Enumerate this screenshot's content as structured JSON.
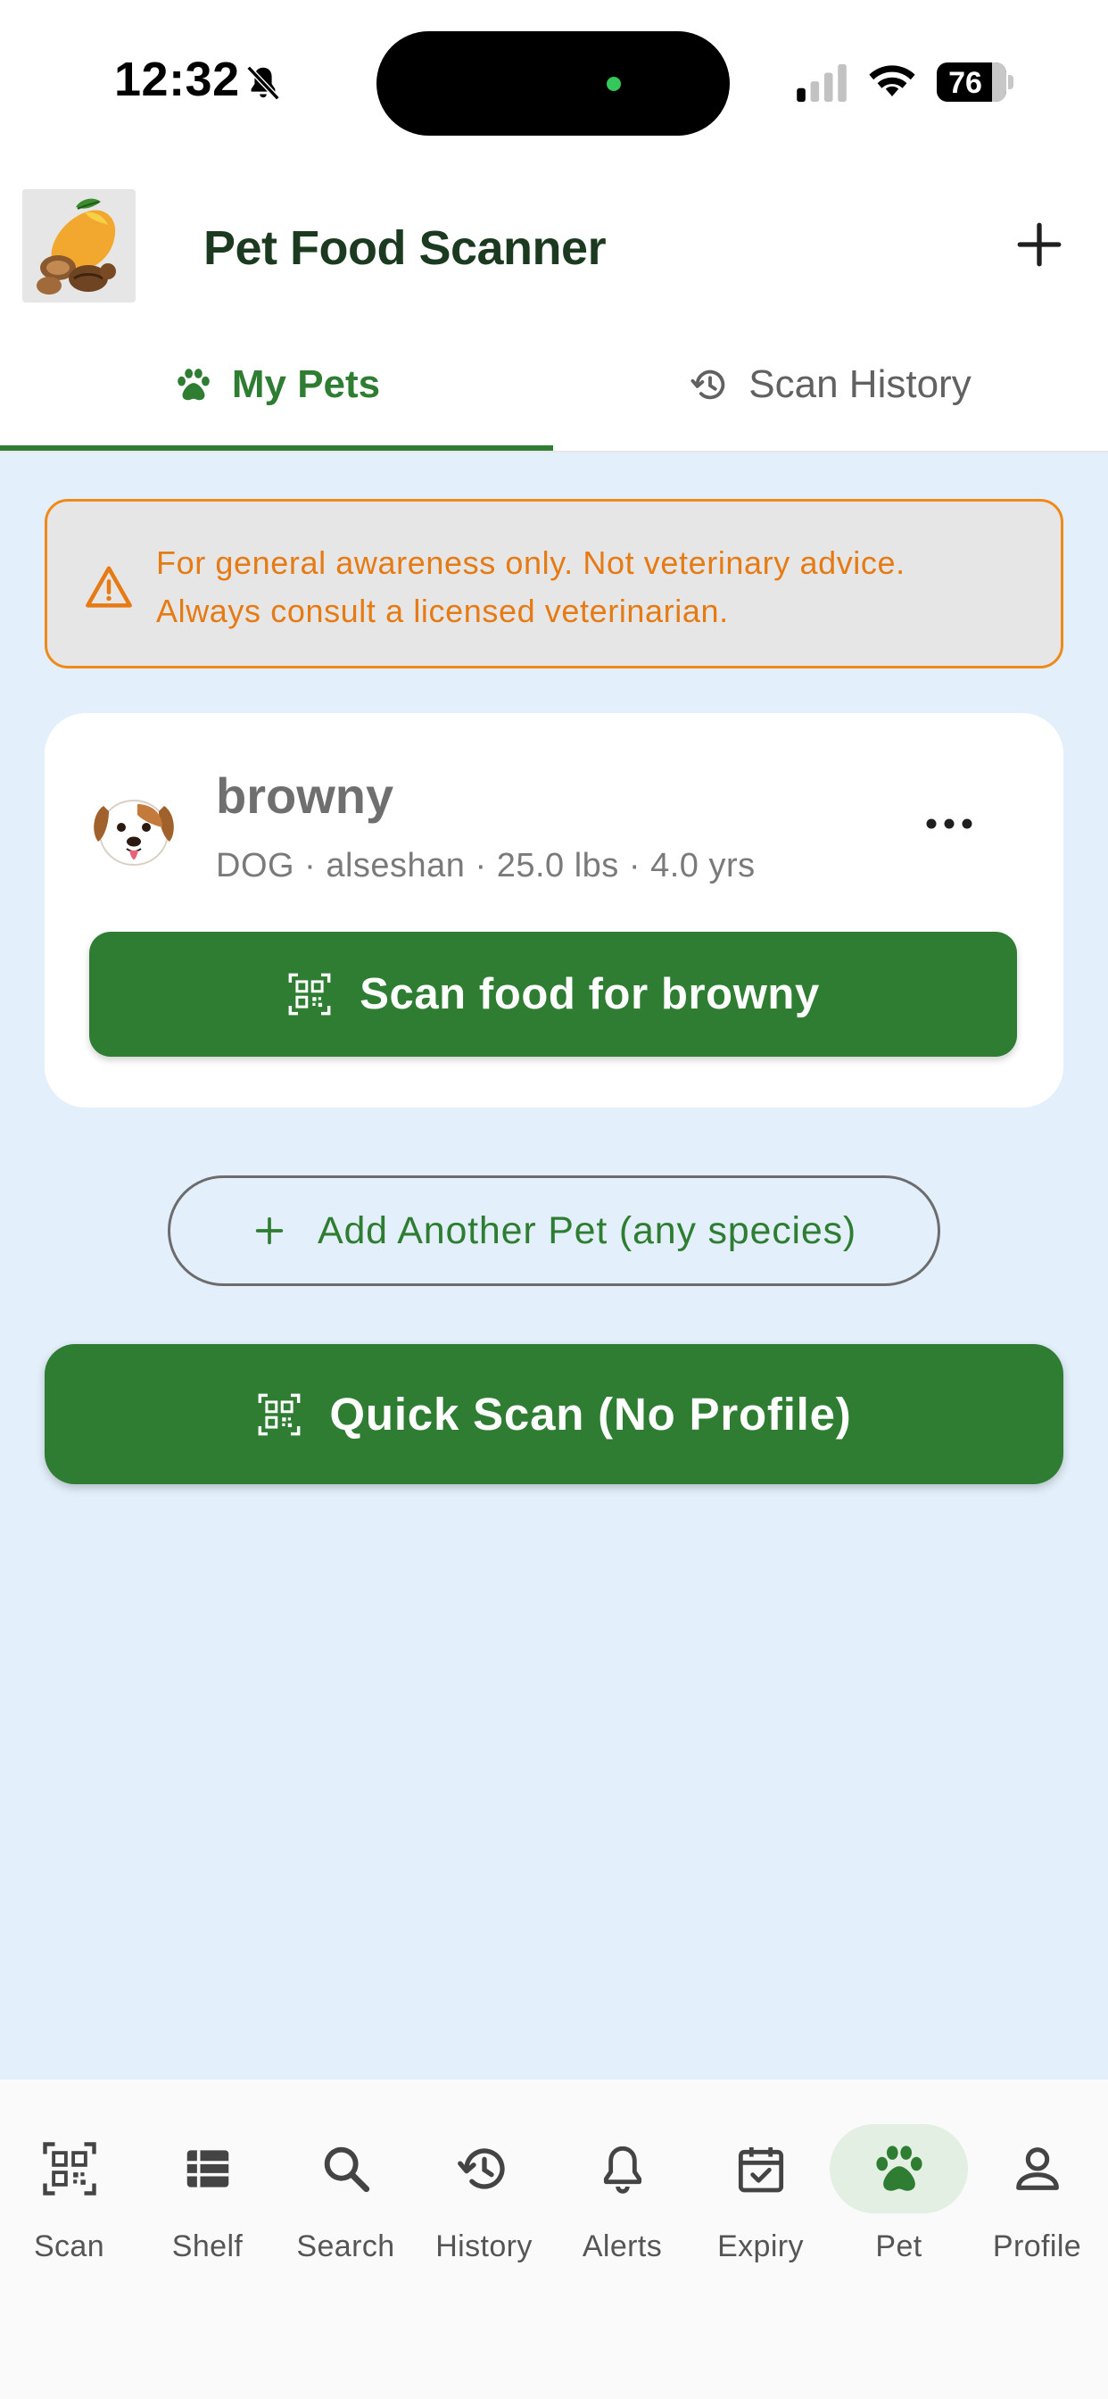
{
  "status_bar": {
    "time": "12:32",
    "battery_level": "76",
    "icons": [
      "bell-slash-icon",
      "signal-icon",
      "wifi-icon",
      "battery-icon"
    ]
  },
  "app_bar": {
    "title": "Pet Food Scanner",
    "logo": "mango-nuts-logo",
    "action_icon": "plus-icon"
  },
  "tabs": [
    {
      "label": "My Pets",
      "icon": "paw-icon",
      "selected": true
    },
    {
      "label": "Scan History",
      "icon": "history-icon",
      "selected": false
    }
  ],
  "disclaimer": {
    "line1": "For general awareness only. Not veterinary advice.",
    "line2": "Always consult a licensed veterinarian.",
    "icon": "warning-icon"
  },
  "pet": {
    "name": "browny",
    "details": "DOG · alseshan · 25.0 lbs · 4.0 yrs",
    "avatar": "dog-face-icon",
    "menu_icon": "more-horizontal-icon",
    "scan_button_label": "Scan food for browny"
  },
  "add_pet_label": "Add Another Pet (any species)",
  "quick_scan_label": "Quick Scan (No Profile)",
  "bottom_nav": [
    {
      "label": "Scan",
      "icon": "qr-scan-icon",
      "active": false
    },
    {
      "label": "Shelf",
      "icon": "shelf-icon",
      "active": false
    },
    {
      "label": "Search",
      "icon": "search-icon",
      "active": false
    },
    {
      "label": "History",
      "icon": "history-icon",
      "active": false
    },
    {
      "label": "Alerts",
      "icon": "bell-icon",
      "active": false
    },
    {
      "label": "Expiry",
      "icon": "calendar-check-icon",
      "active": false
    },
    {
      "label": "Pet",
      "icon": "paw-icon",
      "active": true
    },
    {
      "label": "Profile",
      "icon": "person-icon",
      "active": false
    }
  ],
  "colors": {
    "primary_green": "#2e7d32",
    "warning_orange": "#e67a13",
    "main_background": "#e3f0fb",
    "title_dark_green": "#1b3a1f"
  }
}
